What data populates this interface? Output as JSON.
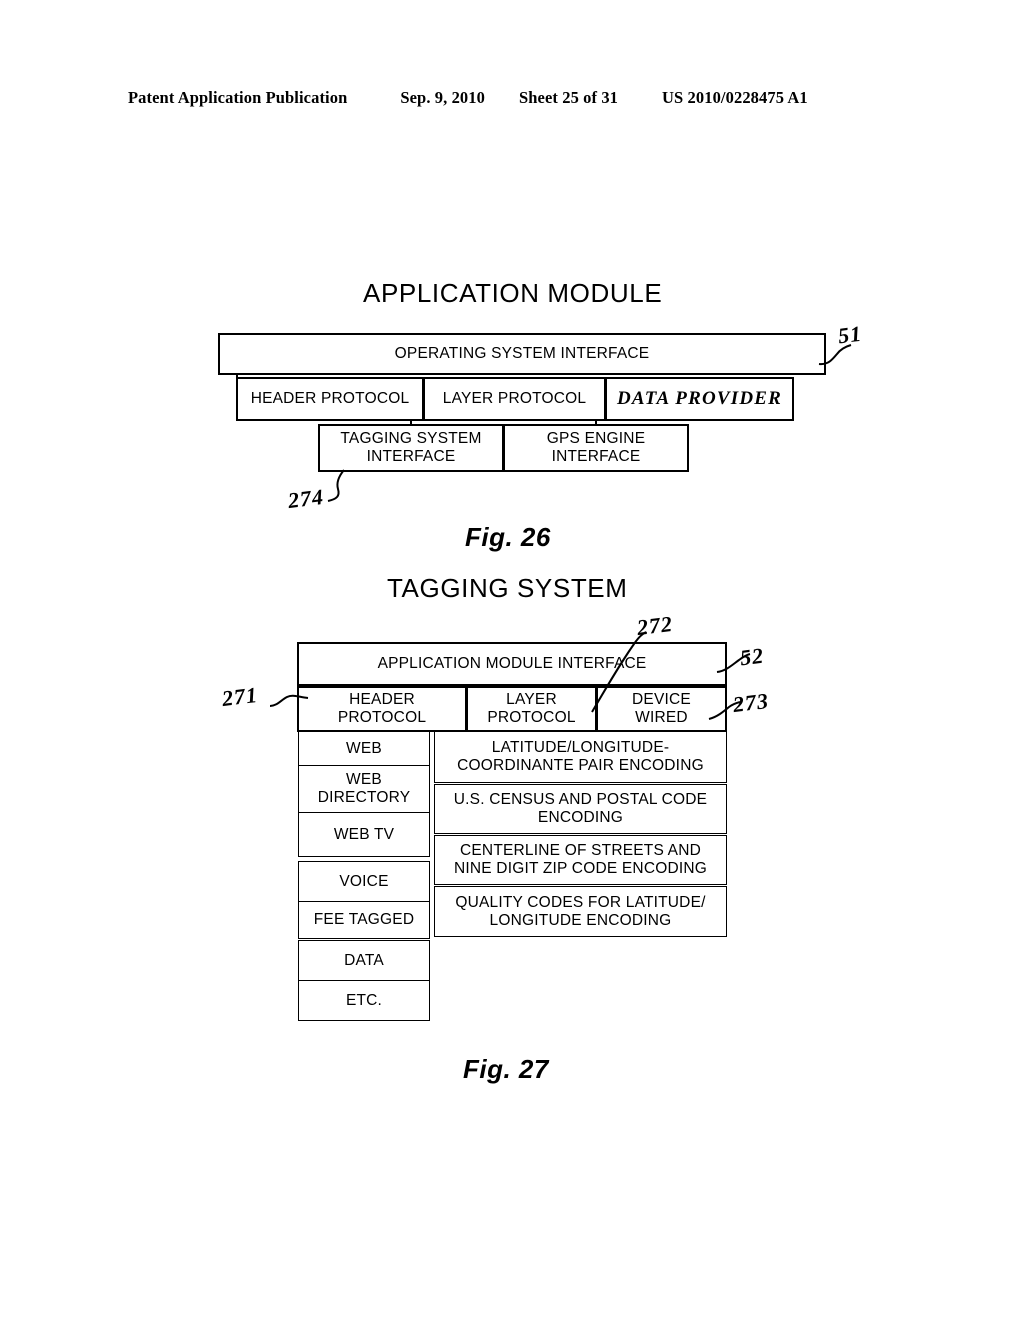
{
  "header": {
    "publication": "Patent Application Publication",
    "date": "Sep. 9, 2010",
    "sheet": "Sheet 25 of 31",
    "patent_number": "US 2010/0228475 A1"
  },
  "fig26": {
    "title": "APPLICATION MODULE",
    "caption": "Fig. 26",
    "os_interface": "OPERATING SYSTEM INTERFACE",
    "row1": [
      "HEADER PROTOCOL",
      "LAYER PROTOCOL",
      "DATA PROVIDER"
    ],
    "row2": [
      "TAGGING SYSTEM\nINTERFACE",
      "GPS ENGINE\nINTERFACE"
    ],
    "ref_os_interface": "51",
    "ref_tagging_system_interface": "274"
  },
  "fig27": {
    "title": "TAGGING SYSTEM",
    "caption": "Fig. 27",
    "app_module_interface": "APPLICATION MODULE INTERFACE",
    "protocol_row": [
      "HEADER\nPROTOCOL",
      "LAYER\nPROTOCOL",
      "DEVICE\nWIRED"
    ],
    "left_column": [
      "WEB",
      "WEB\nDIRECTORY",
      "WEB TV",
      "VOICE",
      "FEE TAGGED",
      "DATA",
      "ETC."
    ],
    "right_column": [
      "LATITUDE/LONGITUDE-\nCOORDINANTE PAIR ENCODING",
      "U.S. CENSUS AND POSTAL CODE\nENCODING",
      "CENTERLINE OF STREETS AND\nNINE DIGIT ZIP CODE ENCODING",
      "QUALITY CODES FOR LATITUDE/\nLONGITUDE ENCODING"
    ],
    "ref_header_protocol": "271",
    "ref_layer_protocol": "272",
    "ref_device_wired": "273",
    "ref_app_module_interface": "52"
  }
}
